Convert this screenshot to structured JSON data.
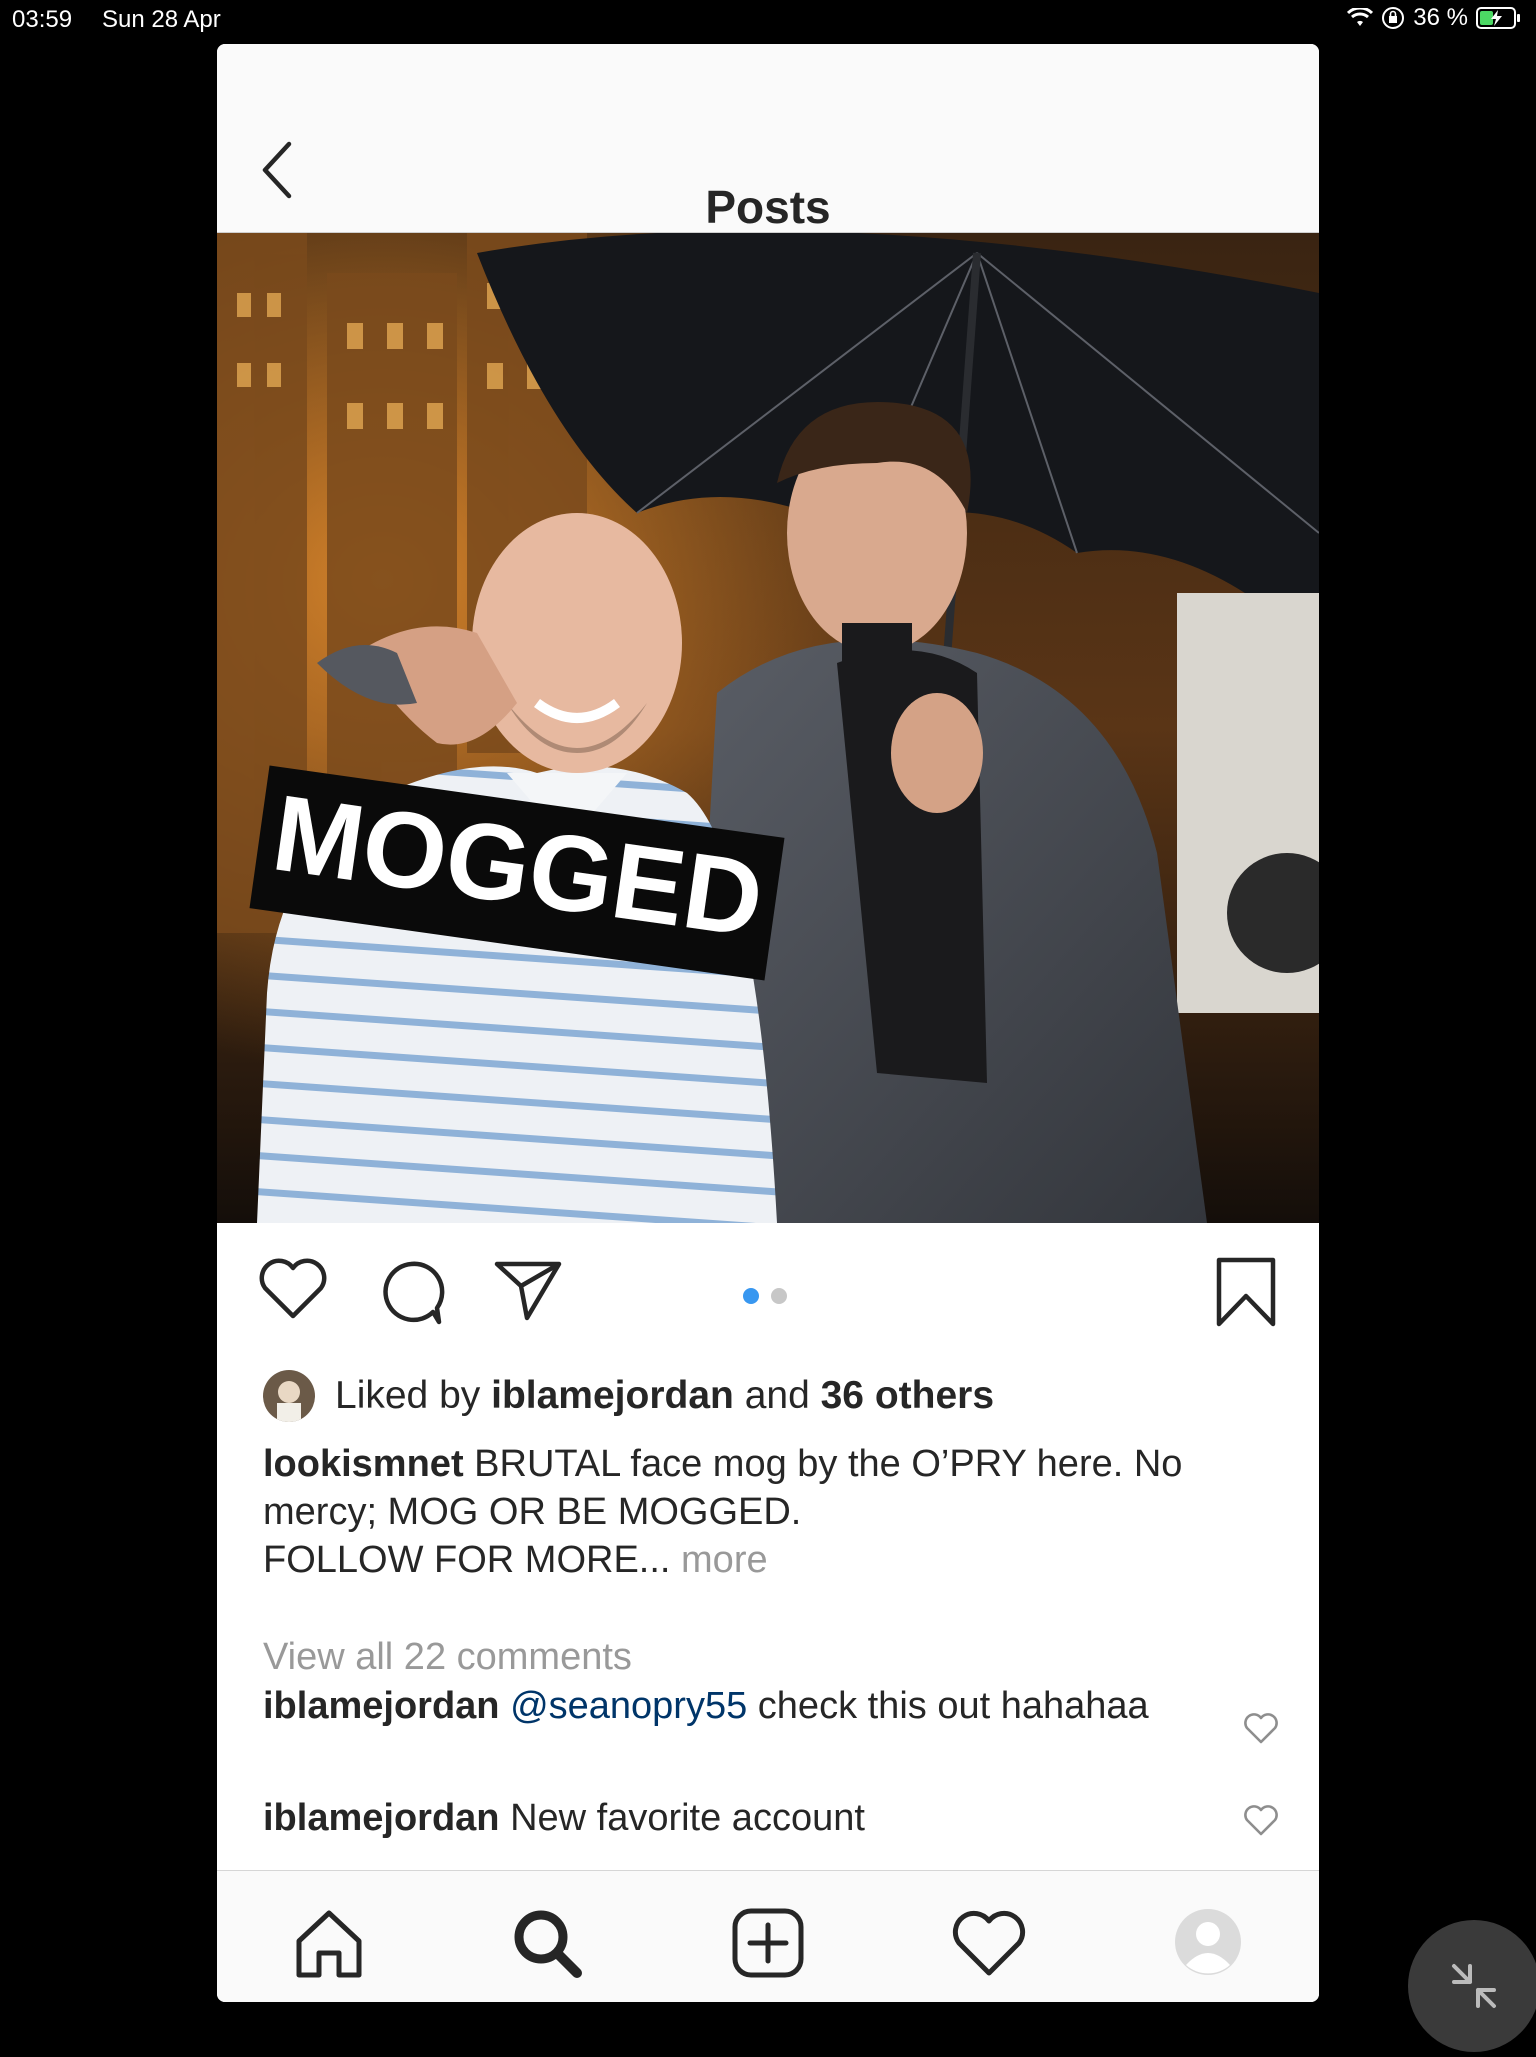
{
  "status": {
    "time": "03:59",
    "date": "Sun 28 Apr",
    "battery": "36 %"
  },
  "nav": {
    "title": "Posts"
  },
  "photo": {
    "overlay_text": "MOGGED"
  },
  "carousel": {
    "count": 2,
    "active": 1
  },
  "likes": {
    "prefix": "Liked by",
    "user": "iblamejordan",
    "and": "and",
    "others": "36 others"
  },
  "caption": {
    "user": "lookismnet",
    "line1": "BRUTAL face mog by the O’PRY here. No mercy; MOG OR BE MOGGED.",
    "line2": "FOLLOW FOR MORE...",
    "more": "more"
  },
  "comments_link": "View all 22 comments",
  "comments": [
    {
      "user": "iblamejordan",
      "mention": "@seanopry55",
      "text": "check this out hahahaa"
    },
    {
      "user": "iblamejordan",
      "mention": "",
      "text": "New favorite account"
    }
  ],
  "colors": {
    "accent": "#3897f0",
    "mention": "#003569",
    "muted": "#999999"
  },
  "icons": [
    "back-icon",
    "heart-icon",
    "comment-icon",
    "share-icon",
    "bookmark-icon",
    "home-icon",
    "search-icon",
    "add-icon",
    "activity-icon",
    "profile-icon"
  ]
}
